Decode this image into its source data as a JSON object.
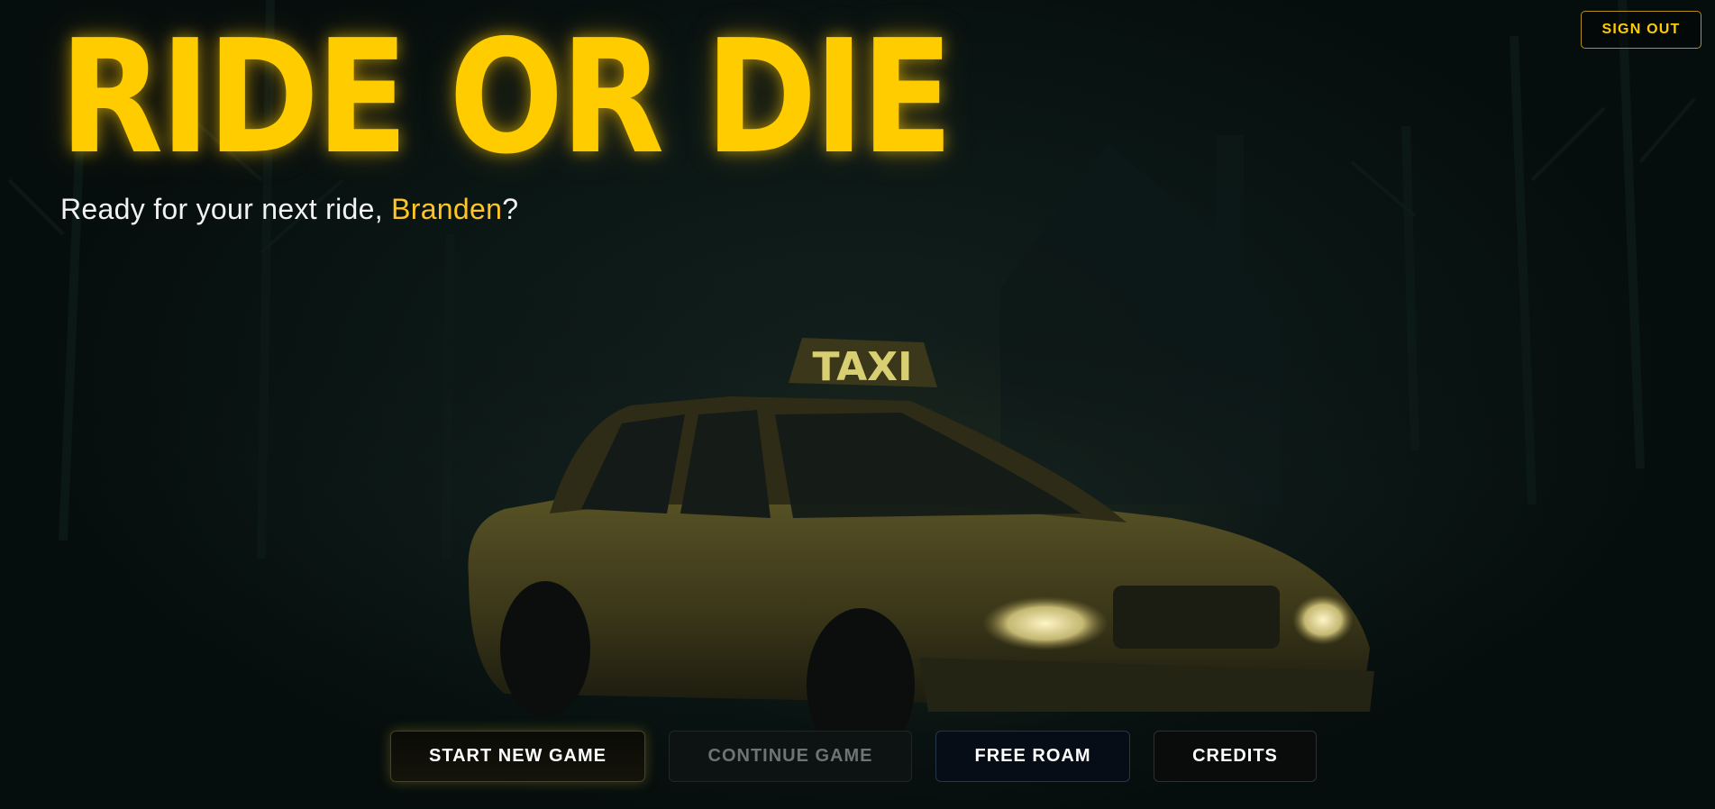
{
  "game": {
    "title": "RIDE OR DIE",
    "greeting_prefix": "Ready for your next ride, ",
    "player_name": "Branden",
    "greeting_suffix": "?"
  },
  "header": {
    "sign_out_label": "SIGN OUT"
  },
  "scene": {
    "taxi_sign_text": "TAXI"
  },
  "menu": {
    "start_new_game": "START NEW GAME",
    "continue_game": "CONTINUE GAME",
    "free_roam": "FREE ROAM",
    "credits": "CREDITS"
  },
  "colors": {
    "accent": "#ffcc00",
    "background": "#071210",
    "disabled_text": "#6e7473"
  }
}
